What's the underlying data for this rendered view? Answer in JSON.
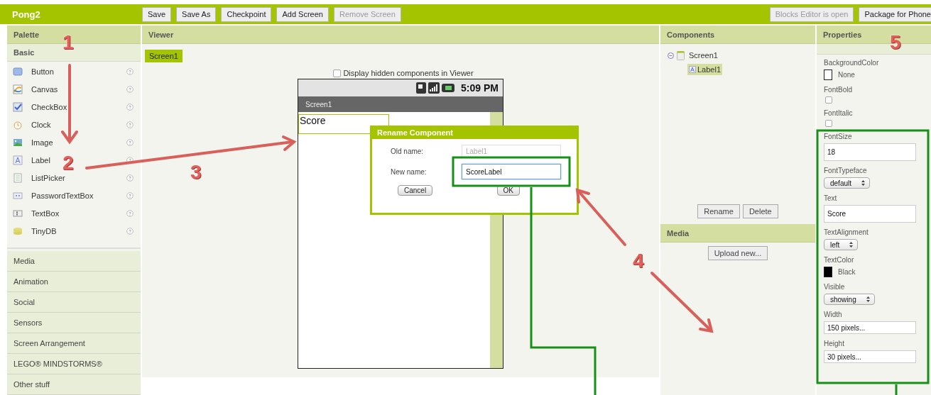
{
  "app": {
    "title": "Pong2"
  },
  "toolbar": {
    "left": [
      {
        "label": "Save",
        "disabled": false
      },
      {
        "label": "Save As",
        "disabled": false
      },
      {
        "label": "Checkpoint",
        "disabled": false
      },
      {
        "label": "Add Screen",
        "disabled": false
      },
      {
        "label": "Remove Screen",
        "disabled": true
      }
    ],
    "right": [
      {
        "label": "Blocks Editor is open",
        "disabled": true
      },
      {
        "label": "Package for Phone",
        "disabled": false
      }
    ]
  },
  "palette": {
    "title": "Palette",
    "open_section": "Basic",
    "items": [
      {
        "label": "Button"
      },
      {
        "label": "Canvas"
      },
      {
        "label": "CheckBox"
      },
      {
        "label": "Clock"
      },
      {
        "label": "Image"
      },
      {
        "label": "Label"
      },
      {
        "label": "ListPicker"
      },
      {
        "label": "PasswordTextBox"
      },
      {
        "label": "TextBox"
      },
      {
        "label": "TinyDB"
      }
    ],
    "sections": [
      "Media",
      "Animation",
      "Social",
      "Sensors",
      "Screen Arrangement",
      "LEGO® MINDSTORMS®",
      "Other stuff"
    ]
  },
  "viewer": {
    "title": "Viewer",
    "screen_tab": "Screen1",
    "hidden_checkbox": {
      "label": "Display hidden components in Viewer",
      "checked": false
    },
    "phone": {
      "time": "5:09 PM",
      "title": "Screen1",
      "label_text": "Score"
    }
  },
  "dialog": {
    "title": "Rename Component",
    "old_name_label": "Old name:",
    "old_name": "Label1",
    "new_name_label": "New name:",
    "new_name": "ScoreLabel",
    "buttons": [
      "Cancel",
      "OK"
    ]
  },
  "components": {
    "title": "Components",
    "tree": [
      {
        "label": "Screen1",
        "expanded": true,
        "selected": false,
        "children": [
          {
            "label": "Label1",
            "selected": true
          }
        ]
      }
    ],
    "buttons": [
      "Rename",
      "Delete"
    ]
  },
  "media": {
    "title": "Media",
    "button": "Upload new..."
  },
  "properties": {
    "title": "Properties",
    "items": [
      {
        "kind": "color",
        "name": "BackgroundColor",
        "value": "None",
        "color": "#ffffff"
      },
      {
        "kind": "checkbox",
        "name": "FontBold",
        "checked": false
      },
      {
        "kind": "checkbox",
        "name": "FontItalic",
        "checked": false
      },
      {
        "kind": "text",
        "name": "FontSize",
        "value": "18"
      },
      {
        "kind": "select",
        "name": "FontTypeface",
        "value": "default"
      },
      {
        "kind": "text",
        "name": "Text",
        "value": "Score"
      },
      {
        "kind": "select",
        "name": "TextAlignment",
        "value": "left"
      },
      {
        "kind": "color",
        "name": "TextColor",
        "value": "Black",
        "color": "#000000"
      },
      {
        "kind": "select",
        "name": "Visible",
        "value": "showing"
      },
      {
        "kind": "text",
        "name": "Width",
        "value": "150 pixels..."
      },
      {
        "kind": "text",
        "name": "Height",
        "value": "30 pixels..."
      }
    ]
  },
  "annotations": {
    "markers": [
      "1",
      "2",
      "3",
      "4",
      "5"
    ]
  }
}
